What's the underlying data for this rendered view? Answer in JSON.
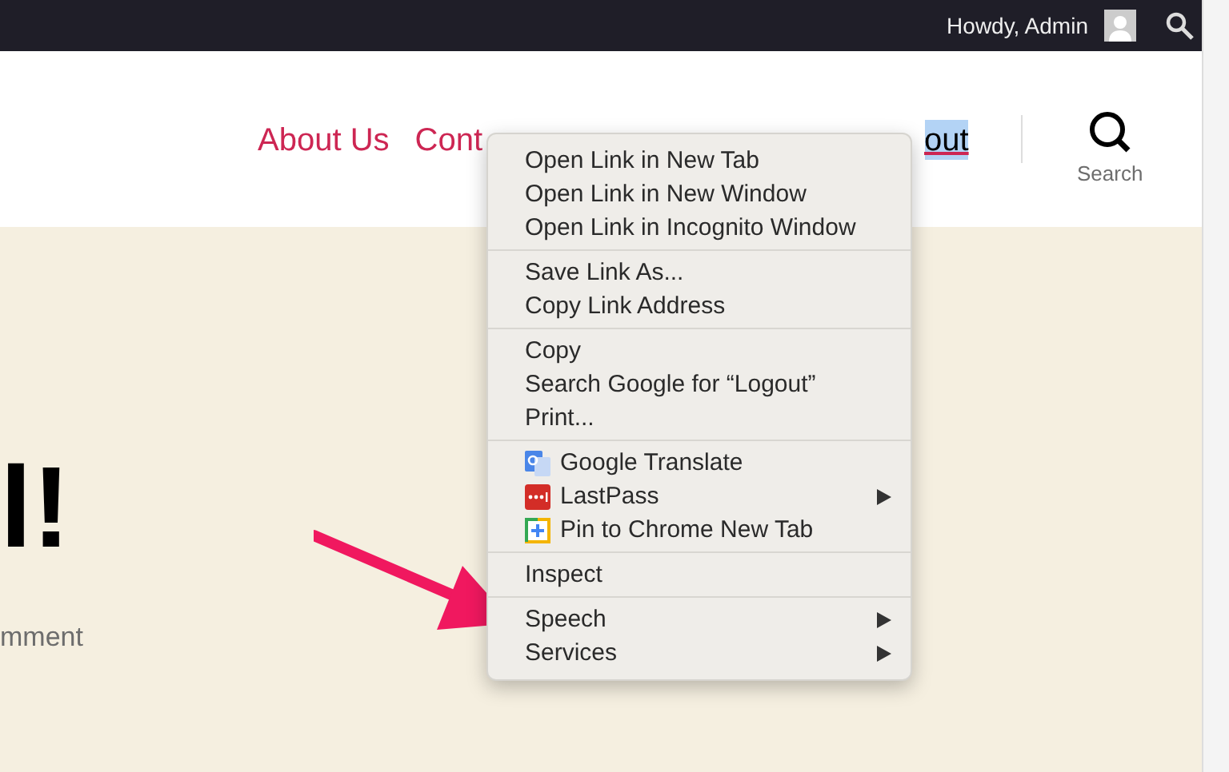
{
  "admin_bar": {
    "greeting": "Howdy, Admin"
  },
  "nav": {
    "items": [
      {
        "label": "About Us",
        "selected": false
      },
      {
        "label": "Cont",
        "selected": false
      },
      {
        "label": "out",
        "selected": true
      }
    ],
    "search_label": "Search"
  },
  "content": {
    "heading": "l!",
    "meta": "mment"
  },
  "context_menu": {
    "groups": [
      [
        {
          "label": "Open Link in New Tab"
        },
        {
          "label": "Open Link in New Window"
        },
        {
          "label": "Open Link in Incognito Window"
        }
      ],
      [
        {
          "label": "Save Link As..."
        },
        {
          "label": "Copy Link Address"
        }
      ],
      [
        {
          "label": "Copy"
        },
        {
          "label": "Search Google for “Logout”"
        },
        {
          "label": "Print..."
        }
      ],
      [
        {
          "label": "Google Translate",
          "kind": "translate",
          "submenu": false
        },
        {
          "label": "LastPass",
          "kind": "lastpass",
          "submenu": true
        },
        {
          "label": "Pin to Chrome New Tab",
          "kind": "pin",
          "submenu": false
        }
      ],
      [
        {
          "label": "Inspect"
        }
      ],
      [
        {
          "label": "Speech",
          "submenu": true
        },
        {
          "label": "Services",
          "submenu": true
        }
      ]
    ]
  }
}
